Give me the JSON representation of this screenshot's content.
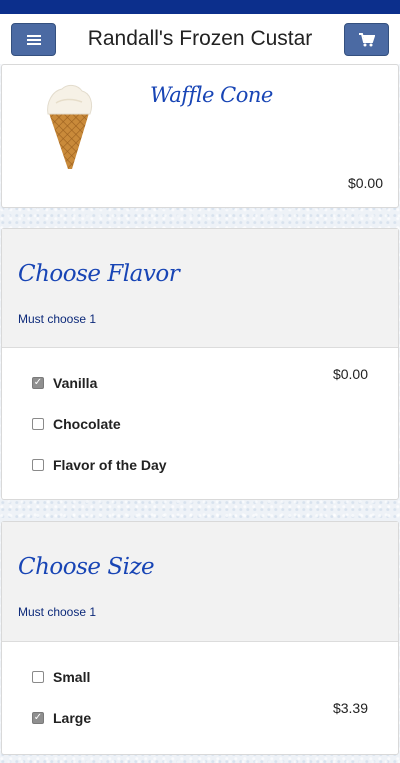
{
  "header": {
    "title": "Randall's Frozen Custar",
    "menu_icon": "hamburger-menu-icon",
    "cart_icon": "shopping-cart-icon",
    "strip_color": "#0c2f8c",
    "button_color": "#4b6aa3"
  },
  "item": {
    "name": "Waffle Cone",
    "price": "$0.00",
    "image_icon": "waffle-cone-image"
  },
  "sections": [
    {
      "title": "Choose Flavor",
      "subtitle": "Must choose 1",
      "price": "$0.00",
      "options": [
        {
          "label": "Vanilla",
          "checked": true
        },
        {
          "label": "Chocolate",
          "checked": false
        },
        {
          "label": "Flavor of the Day",
          "checked": false
        }
      ]
    },
    {
      "title": "Choose Size",
      "subtitle": "Must choose 1",
      "price": "$3.39",
      "options": [
        {
          "label": "Small",
          "checked": false
        },
        {
          "label": "Large",
          "checked": true
        }
      ]
    }
  ],
  "accent_color": "#1845b5"
}
